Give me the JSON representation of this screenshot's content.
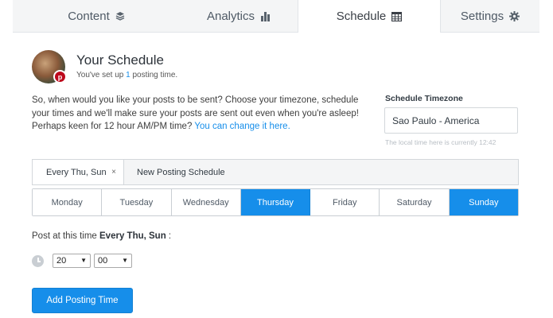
{
  "tabs": [
    {
      "label": "Content",
      "icon": "layers-icon"
    },
    {
      "label": "Analytics",
      "icon": "bar-chart-icon"
    },
    {
      "label": "Schedule",
      "icon": "calendar-icon"
    },
    {
      "label": "Settings",
      "icon": "gear-icon"
    }
  ],
  "header": {
    "title": "Your Schedule",
    "subtitle_pre": "You've set up ",
    "subtitle_count": "1",
    "subtitle_post": " posting time.",
    "badge": "p"
  },
  "intro": {
    "line1": "So, when would you like your posts to be sent? Choose your timezone, schedule your times and we'll make sure your posts are sent out even when you're asleep!",
    "line2_pre": "Perhaps keen for 12 hour AM/PM time? ",
    "line2_link": "You can change it here."
  },
  "timezone": {
    "label": "Schedule Timezone",
    "value": "Sao Paulo - America",
    "hint": "The local time here is currently 12:42"
  },
  "schedule_tabs": {
    "active": "Every Thu, Sun",
    "close": "×",
    "new": "New Posting Schedule"
  },
  "days": [
    "Monday",
    "Tuesday",
    "Wednesday",
    "Thursday",
    "Friday",
    "Saturday",
    "Sunday"
  ],
  "selected_days": [
    "Thursday",
    "Sunday"
  ],
  "post_at": {
    "pre": "Post at this time ",
    "bold": "Every Thu, Sun",
    "post": " :"
  },
  "time": {
    "hour": "20",
    "minute": "00",
    "arrow": "▼"
  },
  "add_button": "Add Posting Time",
  "colors": {
    "accent": "#168eea",
    "pinterest": "#bd081c"
  }
}
